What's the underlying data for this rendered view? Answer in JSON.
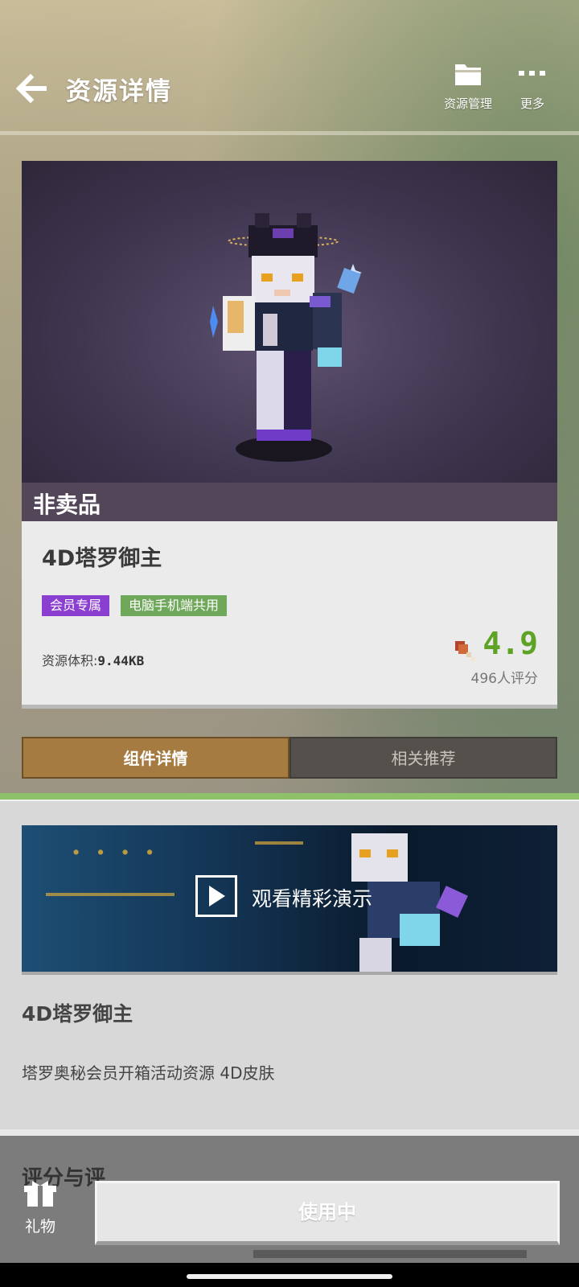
{
  "header": {
    "title": "资源详情",
    "resource_manage_label": "资源管理",
    "more_label": "更多"
  },
  "card": {
    "banner_label": "非卖品",
    "title": "4D塔罗御主",
    "tags": [
      "会员专属",
      "电脑手机端共用"
    ],
    "size_label": "资源体积:",
    "size_value": "9.44KB",
    "rating_score": "4.9",
    "rating_count": "496人评分",
    "tag_colors": {
      "member": "#8a3fd0",
      "platform": "#6fa85a"
    }
  },
  "tabs": [
    {
      "label": "组件详情",
      "active": true
    },
    {
      "label": "相关推荐",
      "active": false
    }
  ],
  "detail": {
    "video_label": "观看精彩演示",
    "title": "4D塔罗御主",
    "description": "塔罗奥秘会员开箱活动资源 4D皮肤"
  },
  "bottom": {
    "section_title": "评分与评",
    "gift_label": "礼物",
    "use_label": "使用中"
  },
  "icons": {
    "back": "back-arrow-icon",
    "folder": "folder-icon",
    "more": "more-dots-icon",
    "drumstick": "drumstick-icon",
    "play": "play-icon",
    "gift": "gift-icon"
  }
}
